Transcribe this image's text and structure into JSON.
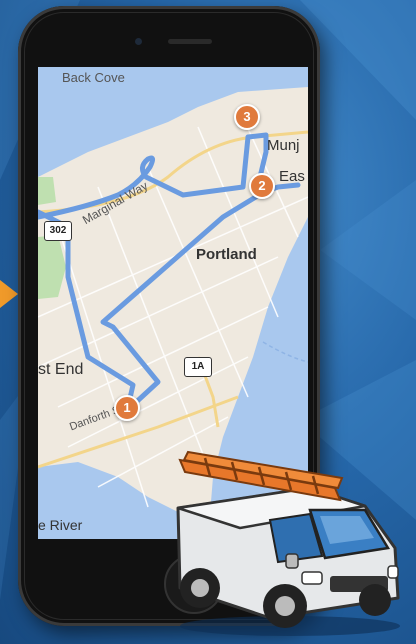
{
  "map": {
    "labels": {
      "back_cove": "Back Cove",
      "marginal_way": "Marginal Way",
      "portland": "Portland",
      "munjoy": "Munj",
      "east": "Eas",
      "west_end": "st End",
      "danforth": "Danforth St",
      "fore_river": "e River"
    },
    "shields": {
      "route_302": "302",
      "route_1a": "1A"
    },
    "pins": [
      "1",
      "2",
      "3"
    ]
  },
  "colors": {
    "background": "#2566a8",
    "route_line": "#6a9be0",
    "pin": "#e07a3c",
    "water": "#a9c8ee",
    "arrow": "#f09a2a"
  }
}
